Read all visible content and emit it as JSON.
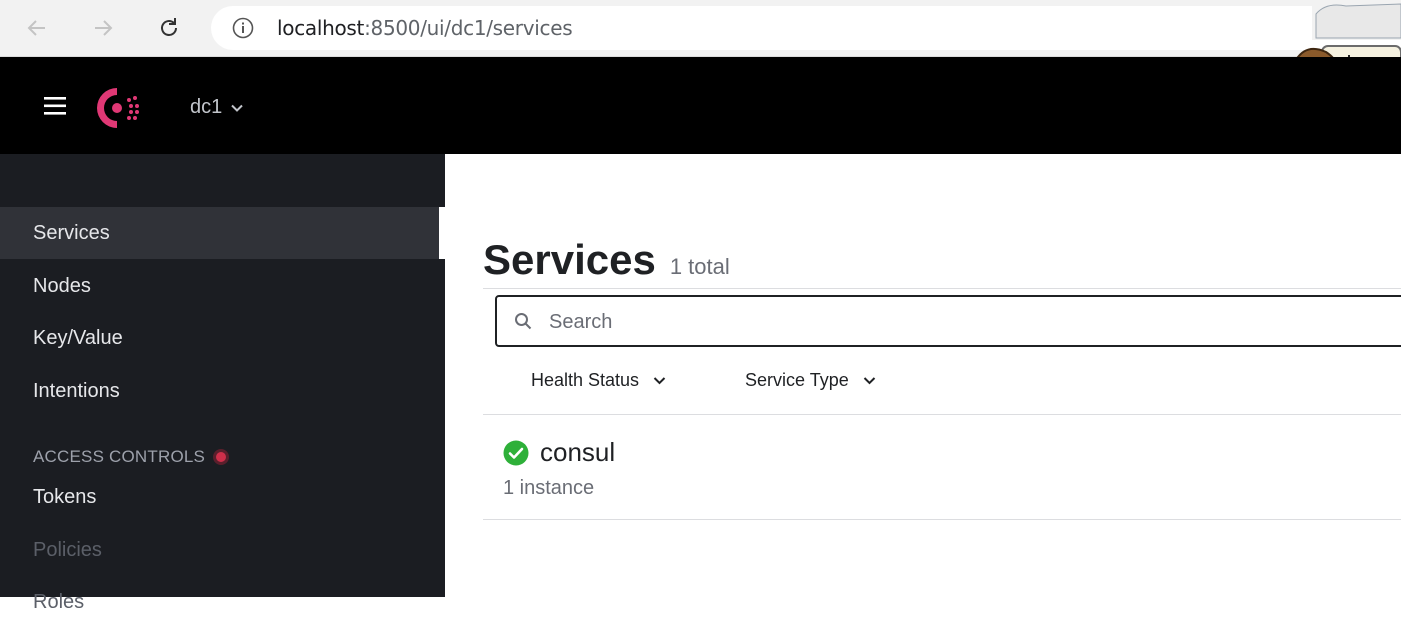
{
  "browser": {
    "url_host": "localhost",
    "url_path": ":8500/ui/dc1/services"
  },
  "topnav": {
    "datacenter": "dc1"
  },
  "sidebar": {
    "items": [
      {
        "label": "Services",
        "active": true
      },
      {
        "label": "Nodes"
      },
      {
        "label": "Key/Value"
      },
      {
        "label": "Intentions"
      }
    ],
    "access_controls": {
      "heading": "ACCESS CONTROLS",
      "items": [
        {
          "label": "Tokens"
        },
        {
          "label": "Policies",
          "disabled": true
        },
        {
          "label": "Roles",
          "disabled": true
        }
      ]
    }
  },
  "main": {
    "title": "Services",
    "total": "1 total",
    "search_placeholder": "Search",
    "filters": [
      {
        "label": "Health Status"
      },
      {
        "label": "Service Type"
      }
    ],
    "services": [
      {
        "name": "consul",
        "instances": "1 instance",
        "status": "passing"
      }
    ]
  },
  "colors": {
    "brand": "#e03875",
    "status_passing": "#2eb039",
    "sidebar_bg": "#1b1d22",
    "topnav_bg": "#000000"
  },
  "icons": [
    "back-arrow-icon",
    "forward-arrow-icon",
    "reload-icon",
    "info-icon",
    "menu-icon",
    "consul-logo",
    "chevron-down-icon",
    "search-icon",
    "check-circle-icon"
  ]
}
